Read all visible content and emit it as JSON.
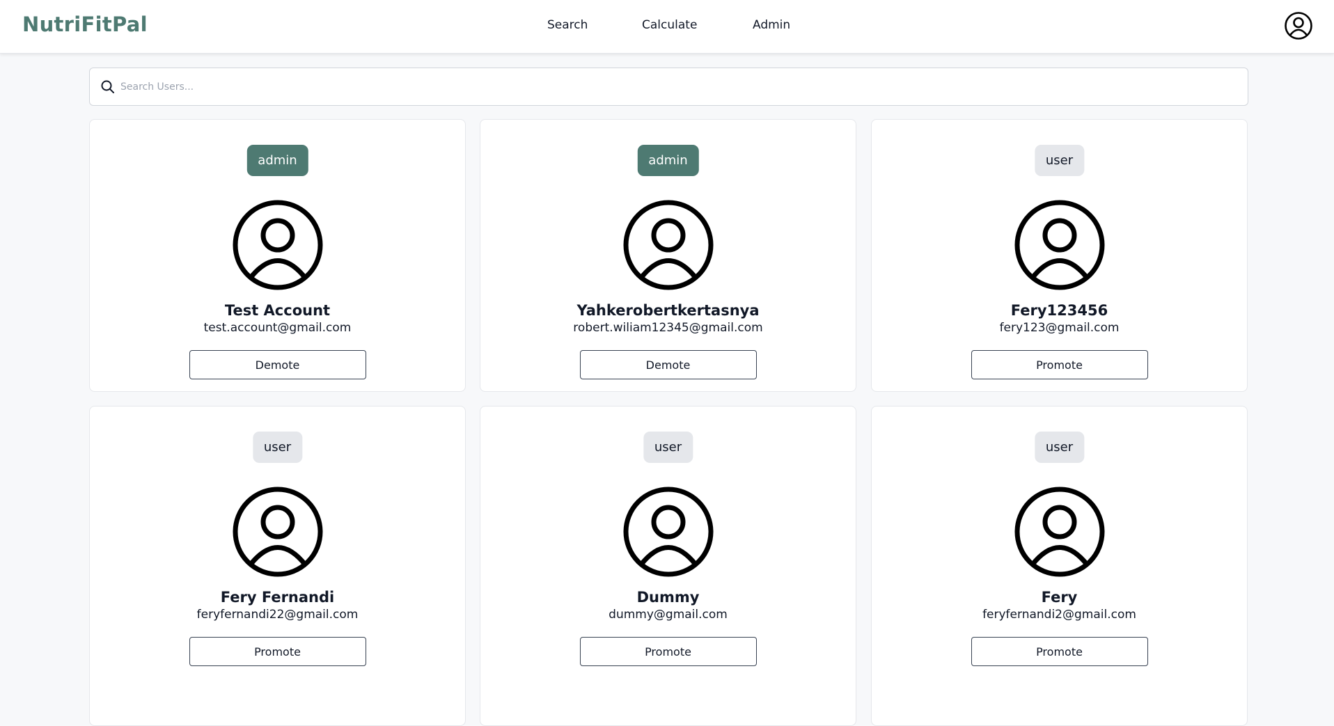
{
  "app": {
    "brand": "NutriFitPal"
  },
  "nav": {
    "items": [
      {
        "label": "Search"
      },
      {
        "label": "Calculate"
      },
      {
        "label": "Admin"
      }
    ],
    "profile_icon": "user-circle-icon"
  },
  "search": {
    "placeholder": "Search Users...",
    "value": "",
    "icon": "magnifier-icon"
  },
  "colors": {
    "brand": "#4e7a72",
    "admin_badge": "#4e7a72",
    "user_badge": "#e5e7eb",
    "background": "#f7f8fa"
  },
  "users": [
    {
      "role": "admin",
      "name": "Test Account",
      "email": "test.account@gmail.com",
      "action": "Demote"
    },
    {
      "role": "admin",
      "name": "Yahkerobertkertasnya",
      "email": "robert.wiliam12345@gmail.com",
      "action": "Demote"
    },
    {
      "role": "user",
      "name": "Fery123456",
      "email": "fery123@gmail.com",
      "action": "Promote"
    },
    {
      "role": "user",
      "name": "Fery Fernandi",
      "email": "feryfernandi22@gmail.com",
      "action": "Promote"
    },
    {
      "role": "user",
      "name": "Dummy",
      "email": "dummy@gmail.com",
      "action": "Promote"
    },
    {
      "role": "user",
      "name": "Fery",
      "email": "feryfernandi2@gmail.com",
      "action": "Promote"
    }
  ]
}
